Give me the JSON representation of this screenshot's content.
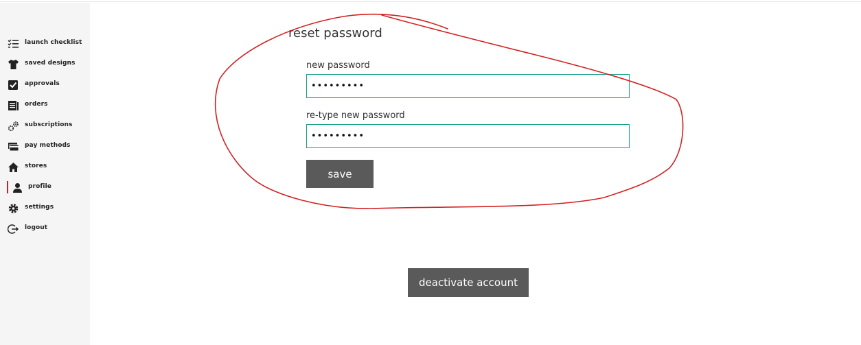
{
  "sidebar": {
    "items": [
      {
        "label": "launch checklist",
        "icon": "checklist-icon"
      },
      {
        "label": "saved designs",
        "icon": "tshirt-icon"
      },
      {
        "label": "approvals",
        "icon": "checkbox-icon"
      },
      {
        "label": "orders",
        "icon": "document-icon"
      },
      {
        "label": "subscriptions",
        "icon": "gears-icon"
      },
      {
        "label": "pay methods",
        "icon": "credit-card-icon"
      },
      {
        "label": "stores",
        "icon": "home-icon"
      },
      {
        "label": "profile",
        "icon": "user-icon",
        "active": true
      },
      {
        "label": "settings",
        "icon": "gear-icon"
      },
      {
        "label": "logout",
        "icon": "logout-icon"
      }
    ]
  },
  "reset_password": {
    "title": "reset password",
    "new_password_label": "new password",
    "new_password_value": "•••••••••",
    "retype_label": "re-type new password",
    "retype_value": "•••••••••",
    "save_label": "save"
  },
  "deactivate_label": "deactivate account",
  "colors": {
    "accent_border": "#16a08a",
    "button_bg": "#5a5a5a",
    "active_marker": "#cf1f1f",
    "annotation": "#d42020"
  }
}
